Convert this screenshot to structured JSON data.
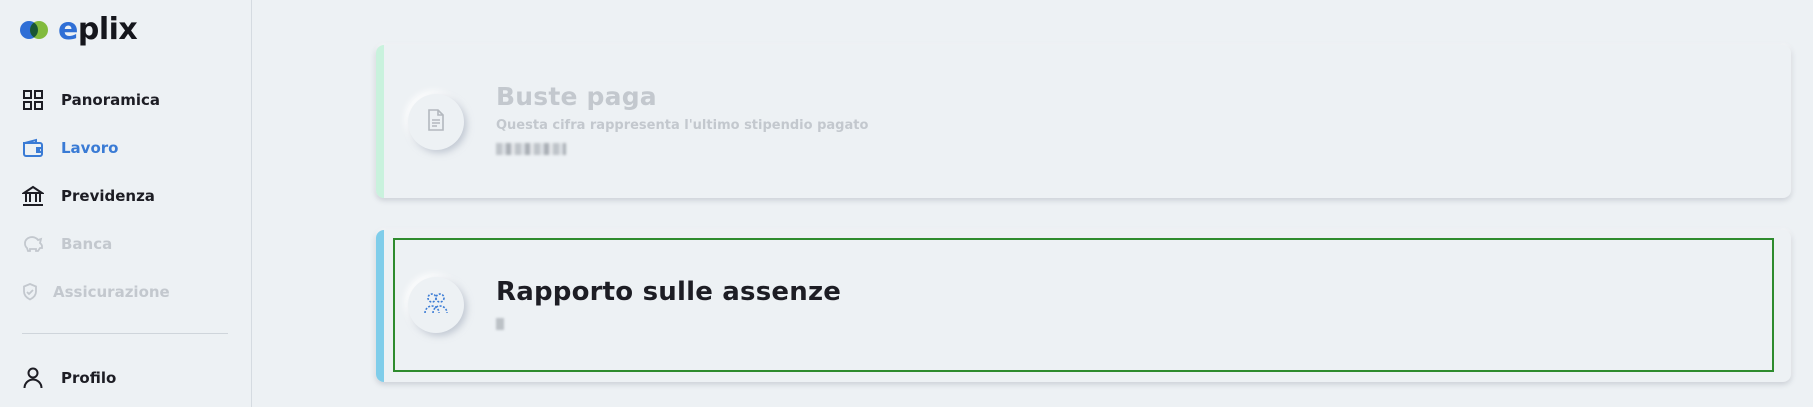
{
  "logo": {
    "text_e": "e",
    "text_rest": "plix"
  },
  "sidebar": {
    "items": [
      {
        "label": "Panoramica",
        "icon": "grid-icon",
        "state": "default"
      },
      {
        "label": "Lavoro",
        "icon": "wallet-icon",
        "state": "active"
      },
      {
        "label": "Previdenza",
        "icon": "bank-icon",
        "state": "default"
      },
      {
        "label": "Banca",
        "icon": "piggy-bank-icon",
        "state": "disabled"
      },
      {
        "label": "Assicurazione",
        "icon": "shield-icon",
        "state": "disabled"
      }
    ],
    "profile": {
      "label": "Profilo",
      "icon": "user-icon"
    }
  },
  "cards": [
    {
      "title": "Buste paga",
      "subtitle": "Questa cifra rappresenta l'ultimo stipendio pagato",
      "icon": "document-icon",
      "state": "disabled",
      "accent_color": "#c9f2dd"
    },
    {
      "title": "Rapporto sulle assenze",
      "icon": "users-icon",
      "state": "active",
      "accent_color": "#7fcdea"
    }
  ],
  "colors": {
    "background": "#edf1f4",
    "active": "#3a7bd5",
    "disabled": "#c3c8ce",
    "highlight_border": "#2e8b2e"
  }
}
